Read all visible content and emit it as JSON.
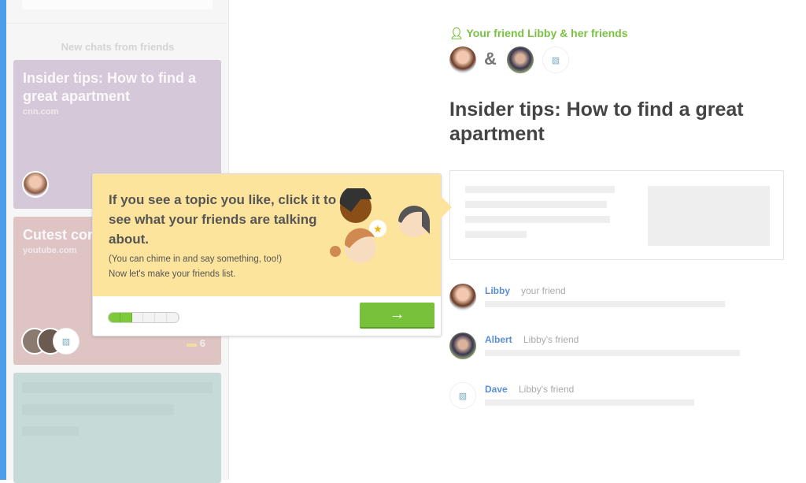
{
  "sidebar": {
    "section_title": "New chats from friends",
    "cards": [
      {
        "title": "Insider tips: How to find a great apartment",
        "source": "cnn.com",
        "color": "#d5c8d8"
      },
      {
        "title": "Cutest cor",
        "source": "youtube.com",
        "comment_count": "6",
        "color": "#dfc4c4"
      },
      {
        "color": "#c6dbd8"
      }
    ]
  },
  "header": {
    "friend_label": "Your friend Libby & her friends",
    "ampersand": "&"
  },
  "article": {
    "title": "Insider tips: How to find a great apartment"
  },
  "friends": [
    {
      "name": "Libby",
      "relation": "your friend"
    },
    {
      "name": "Albert",
      "relation": "Libby's friend"
    },
    {
      "name": "Dave",
      "relation": "Libby's friend"
    }
  ],
  "tooltip": {
    "heading": "If you see a topic you like, click it to see what your friends are talking about.",
    "line1": "(You can chime in and say something, too!)",
    "line2": "Now let's make your friends list.",
    "progress_step": 2,
    "progress_total": 6,
    "next_label": "→"
  },
  "colors": {
    "accent_green": "#7ac143",
    "link_blue": "#5b8fd6",
    "tooltip_yellow": "#fde49c",
    "left_bar": "#4b9ee9"
  }
}
